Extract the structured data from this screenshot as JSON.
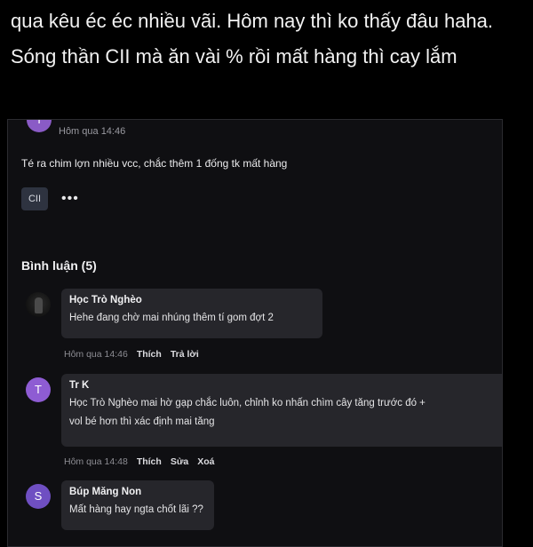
{
  "header": {
    "text": "qua kêu éc éc nhiều vãi. Hôm nay thì ko thấy đâu haha. Sóng thần CII mà ăn vài % rồi mất hàng thì cay lắm"
  },
  "post": {
    "avatar_initial": "I",
    "time": "Hôm qua 14:46",
    "content": "Té ra chim lợn nhiều vcc, chắc thêm 1 đống tk mất hàng",
    "tag": "CII",
    "more": "•••"
  },
  "comments": {
    "title": "Bình luận (5)",
    "items": [
      {
        "name": "Học Trò Nghèo",
        "text": "Hehe đang chờ mai nhúng thêm tí gom đợt 2",
        "time": "Hôm qua 14:46",
        "actions": [
          "Thích",
          "Trả lời"
        ]
      },
      {
        "initial": "T",
        "avatar_color": "#8e5cd3",
        "name": "Tr K",
        "text_line1": "Học Trò Nghèo mai hờ gạp chắc luôn, chỉnh ko nhấn chìm cây tăng trước đó +",
        "text_line2": "vol bé hơn thì xác định mai tăng",
        "time": "Hôm qua 14:48",
        "actions": [
          "Thích",
          "Sửa",
          "Xoá"
        ]
      },
      {
        "initial": "S",
        "avatar_color": "#6f4fc2",
        "name": "Búp Măng Non",
        "text": "Mất hàng hay ngta chốt lãi ??"
      }
    ]
  }
}
